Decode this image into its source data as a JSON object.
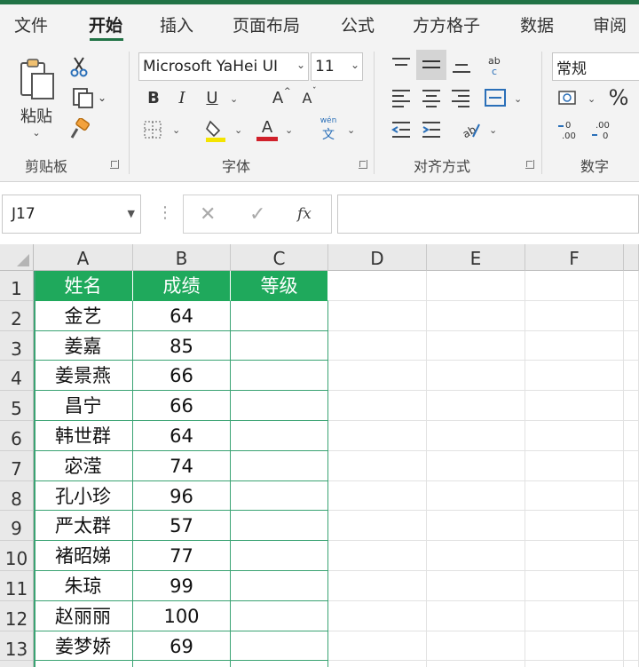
{
  "ribbon_tabs": [
    "文件",
    "开始",
    "插入",
    "页面布局",
    "公式",
    "方方格子",
    "数据",
    "审阅"
  ],
  "active_tab": "开始",
  "clipboard": {
    "paste_label": "粘贴",
    "group_label": "剪贴板"
  },
  "font": {
    "family": "Microsoft YaHei UI",
    "size": "11",
    "group_label": "字体",
    "bold": "B",
    "italic": "I",
    "underline": "U",
    "grow": "A",
    "shrink": "A",
    "font_color": "A",
    "wen": "wén",
    "wen_char": "文",
    "fill_color": "#f4e400",
    "text_color": "#d0202a"
  },
  "alignment": {
    "group_label": "对齐方式"
  },
  "number": {
    "format": "常规",
    "percent": "%",
    "group_label": "数字"
  },
  "formula_bar": {
    "name_box": "J17",
    "fx": "fx",
    "formula": ""
  },
  "accent_color": "#217346",
  "table_header_color": "#1fa95c",
  "columns": [
    "A",
    "B",
    "C",
    "D",
    "E",
    "F"
  ],
  "rows": [
    "1",
    "2",
    "3",
    "4",
    "5",
    "6",
    "7",
    "8",
    "9",
    "10",
    "11",
    "12",
    "13"
  ],
  "table": {
    "headers": [
      "姓名",
      "成绩",
      "等级"
    ],
    "data": [
      [
        "金艺",
        "64",
        ""
      ],
      [
        "姜嘉",
        "85",
        ""
      ],
      [
        "姜景燕",
        "66",
        ""
      ],
      [
        "昌宁",
        "66",
        ""
      ],
      [
        "韩世群",
        "64",
        ""
      ],
      [
        "宓滢",
        "74",
        ""
      ],
      [
        "孔小珍",
        "96",
        ""
      ],
      [
        "严太群",
        "57",
        ""
      ],
      [
        "褚昭娣",
        "77",
        ""
      ],
      [
        "朱琼",
        "99",
        ""
      ],
      [
        "赵丽丽",
        "100",
        ""
      ],
      [
        "姜梦娇",
        "69",
        ""
      ]
    ]
  }
}
